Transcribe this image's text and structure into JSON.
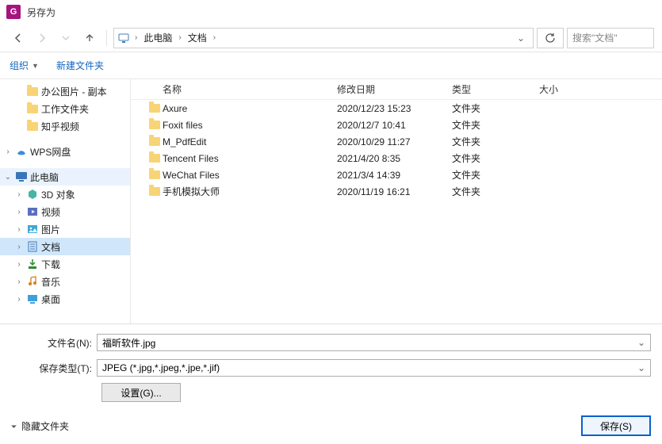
{
  "window": {
    "title": "另存为"
  },
  "breadcrumb": {
    "items": [
      "此电脑",
      "文档"
    ]
  },
  "search": {
    "placeholder": "搜索\"文档\""
  },
  "toolbar": {
    "organize": "组织",
    "new_folder": "新建文件夹"
  },
  "tree": {
    "items": [
      {
        "label": "办公图片 - 副本",
        "indent": 1,
        "icon": "folder",
        "tw": ""
      },
      {
        "label": "工作文件夹",
        "indent": 1,
        "icon": "folder",
        "tw": ""
      },
      {
        "label": "知乎视频",
        "indent": 1,
        "icon": "folder",
        "tw": ""
      },
      {
        "label": "",
        "indent": 0,
        "icon": "",
        "tw": "",
        "blank": true
      },
      {
        "label": "WPS网盘",
        "indent": 0,
        "icon": "wps",
        "tw": "▸"
      },
      {
        "label": "",
        "indent": 0,
        "icon": "",
        "tw": "",
        "blank": true
      },
      {
        "label": "此电脑",
        "indent": 0,
        "icon": "pc",
        "tw": "▾",
        "hover": true
      },
      {
        "label": "3D 对象",
        "indent": 1,
        "icon": "3d",
        "tw": "▸"
      },
      {
        "label": "视频",
        "indent": 1,
        "icon": "video",
        "tw": "▸"
      },
      {
        "label": "图片",
        "indent": 1,
        "icon": "pictures",
        "tw": "▸"
      },
      {
        "label": "文档",
        "indent": 1,
        "icon": "docs",
        "tw": "▸",
        "selected": true
      },
      {
        "label": "下载",
        "indent": 1,
        "icon": "downloads",
        "tw": "▸"
      },
      {
        "label": "音乐",
        "indent": 1,
        "icon": "music",
        "tw": "▸"
      },
      {
        "label": "桌面",
        "indent": 1,
        "icon": "desktop",
        "tw": "▸"
      }
    ]
  },
  "list": {
    "headers": {
      "name": "名称",
      "date": "修改日期",
      "type": "类型",
      "size": "大小"
    },
    "rows": [
      {
        "name": "Axure",
        "date": "2020/12/23 15:23",
        "type": "文件夹"
      },
      {
        "name": "Foxit files",
        "date": "2020/12/7 10:41",
        "type": "文件夹"
      },
      {
        "name": "M_PdfEdit",
        "date": "2020/10/29 11:27",
        "type": "文件夹"
      },
      {
        "name": "Tencent Files",
        "date": "2021/4/20 8:35",
        "type": "文件夹"
      },
      {
        "name": "WeChat Files",
        "date": "2021/3/4 14:39",
        "type": "文件夹"
      },
      {
        "name": "手机模拟大师",
        "date": "2020/11/19 16:21",
        "type": "文件夹"
      }
    ]
  },
  "form": {
    "filename_label": "文件名(N):",
    "filename_value": "福昕软件.jpg",
    "filetype_label": "保存类型(T):",
    "filetype_value": "JPEG (*.jpg,*.jpeg,*.jpe,*.jif)",
    "settings_label": "设置(G)...",
    "hide_folders": "隐藏文件夹",
    "save_label": "保存(S)"
  }
}
